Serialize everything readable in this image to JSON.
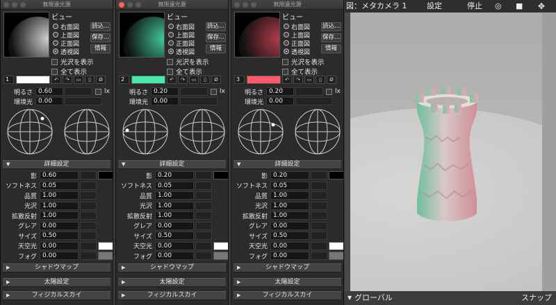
{
  "window_title": "無限遠光源",
  "view_label": "ビュー",
  "view_options": [
    "右面図",
    "上面図",
    "正面図",
    "透視図"
  ],
  "side_buttons": [
    "読込...",
    "保存...",
    "情報"
  ],
  "show_gloss": "光沢を表示",
  "show_all": "全て表示",
  "brightness_label": "明るさ",
  "ambient_label": "環境光",
  "lux_label": "lx",
  "detail_settings": "詳細設定",
  "detail_labels": [
    "影",
    "ソフトネス",
    "品質",
    "光沢",
    "拡散反射",
    "グレア",
    "サイズ",
    "天空光",
    "フォグ"
  ],
  "section_shadowmap": "シャドウマップ",
  "section_sun": "太陽設定",
  "section_sky": "フィジカルスカイ",
  "icons": [
    "undo-icon",
    "redo-icon",
    "copy-icon",
    "paste-icon",
    "null-icon"
  ],
  "panels": [
    {
      "number": "1",
      "color": "#ffffff",
      "preview": "#cfcfcf",
      "brightness": "0.60",
      "ambient": "0.00",
      "details": [
        "0.60",
        "0.05",
        "1.00",
        "1.00",
        "1.00",
        "0.00",
        "0.50",
        "0.00",
        "0.00"
      ]
    },
    {
      "number": "2",
      "color": "#48e8a8",
      "preview": "#3fc69a",
      "brightness": "0.20",
      "ambient": "0.00",
      "details": [
        "0.20",
        "0.05",
        "1.00",
        "1.00",
        "1.00",
        "0.00",
        "0.50",
        "0.00",
        "0.00"
      ]
    },
    {
      "number": "3",
      "color": "#ff5a66",
      "preview": "#b23c48",
      "brightness": "0.20",
      "ambient": "0.00",
      "details": [
        "0.20",
        "0.05",
        "1.00",
        "1.00",
        "1.00",
        "0.00",
        "0.50",
        "0.00",
        "0.00"
      ]
    }
  ],
  "viewport": {
    "camera": "図：メタカメラ 1",
    "settings": "設定",
    "stop": "停止",
    "snap": "スナップ",
    "global": "グローバル"
  }
}
